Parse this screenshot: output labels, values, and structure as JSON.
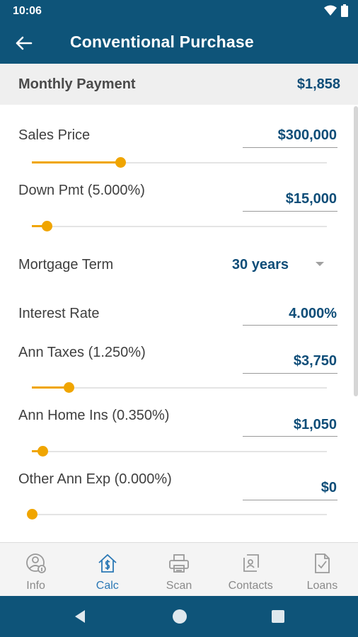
{
  "status_bar": {
    "time": "10:06"
  },
  "app_bar": {
    "title": "Conventional Purchase"
  },
  "summary": {
    "label": "Monthly Payment",
    "value": "$1,858"
  },
  "fields": {
    "sales_price": {
      "label": "Sales Price",
      "value": "$300,000",
      "slider_fraction": 0.3
    },
    "down_payment": {
      "label": "Down Pmt (5.000%)",
      "value": "$15,000",
      "slider_fraction": 0.05
    },
    "mortgage_term": {
      "label": "Mortgage Term",
      "value": "30 years"
    },
    "interest_rate": {
      "label": "Interest Rate",
      "value": "4.000%"
    },
    "ann_taxes": {
      "label": "Ann Taxes (1.250%)",
      "value": "$3,750",
      "slider_fraction": 0.125
    },
    "ann_home_ins": {
      "label": "Ann Home Ins (0.350%)",
      "value": "$1,050",
      "slider_fraction": 0.035
    },
    "other_ann_exp": {
      "label": "Other Ann Exp (0.000%)",
      "value": "$0",
      "slider_fraction": 0.0
    }
  },
  "bottom_nav": {
    "items": [
      {
        "label": "Info",
        "icon": "person-info-icon",
        "active": false
      },
      {
        "label": "Calc",
        "icon": "house-dollar-icon",
        "active": true
      },
      {
        "label": "Scan",
        "icon": "printer-icon",
        "active": false
      },
      {
        "label": "Contacts",
        "icon": "contacts-icon",
        "active": false
      },
      {
        "label": "Loans",
        "icon": "document-check-icon",
        "active": false
      }
    ]
  },
  "colors": {
    "primary": "#0e5479",
    "accent": "#f0a500",
    "value_text": "#0e4d78",
    "active_nav": "#2b78b5"
  }
}
